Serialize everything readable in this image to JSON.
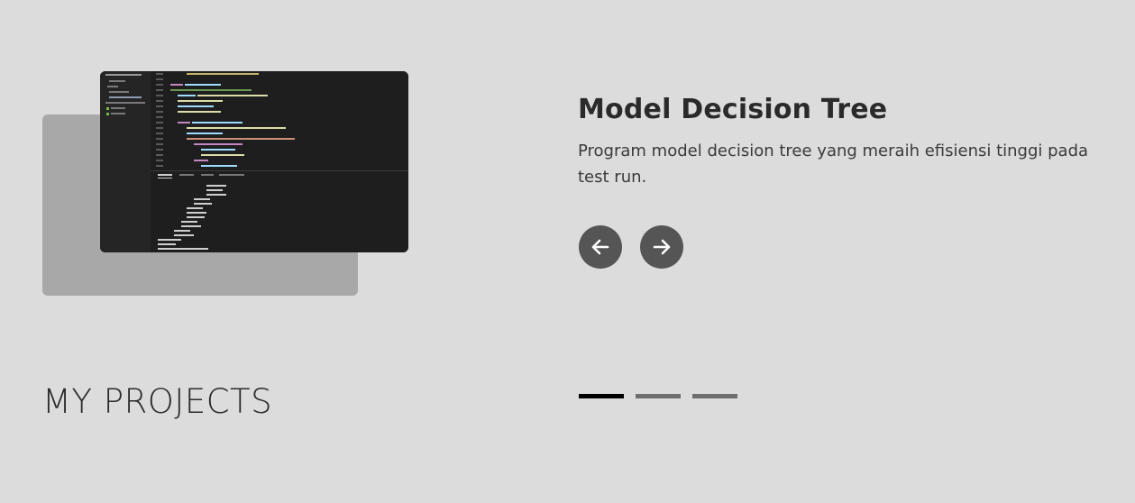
{
  "project": {
    "title": "Model Decision Tree",
    "description": "Program model decision tree yang meraih efisiensi tinggi pada test run.",
    "image_icon": "code-editor-screenshot"
  },
  "navigation": {
    "prev_icon": "arrow-left-icon",
    "next_icon": "arrow-right-icon"
  },
  "section": {
    "title": "MY PROJECTS"
  },
  "pagination": {
    "count": 3,
    "active_index": 0
  },
  "colors": {
    "background": "#dcdcdc",
    "button": "#555555",
    "dot_active": "#000000",
    "dot_inactive": "#6e6e6e",
    "shadow_card": "#a8a8a8"
  }
}
